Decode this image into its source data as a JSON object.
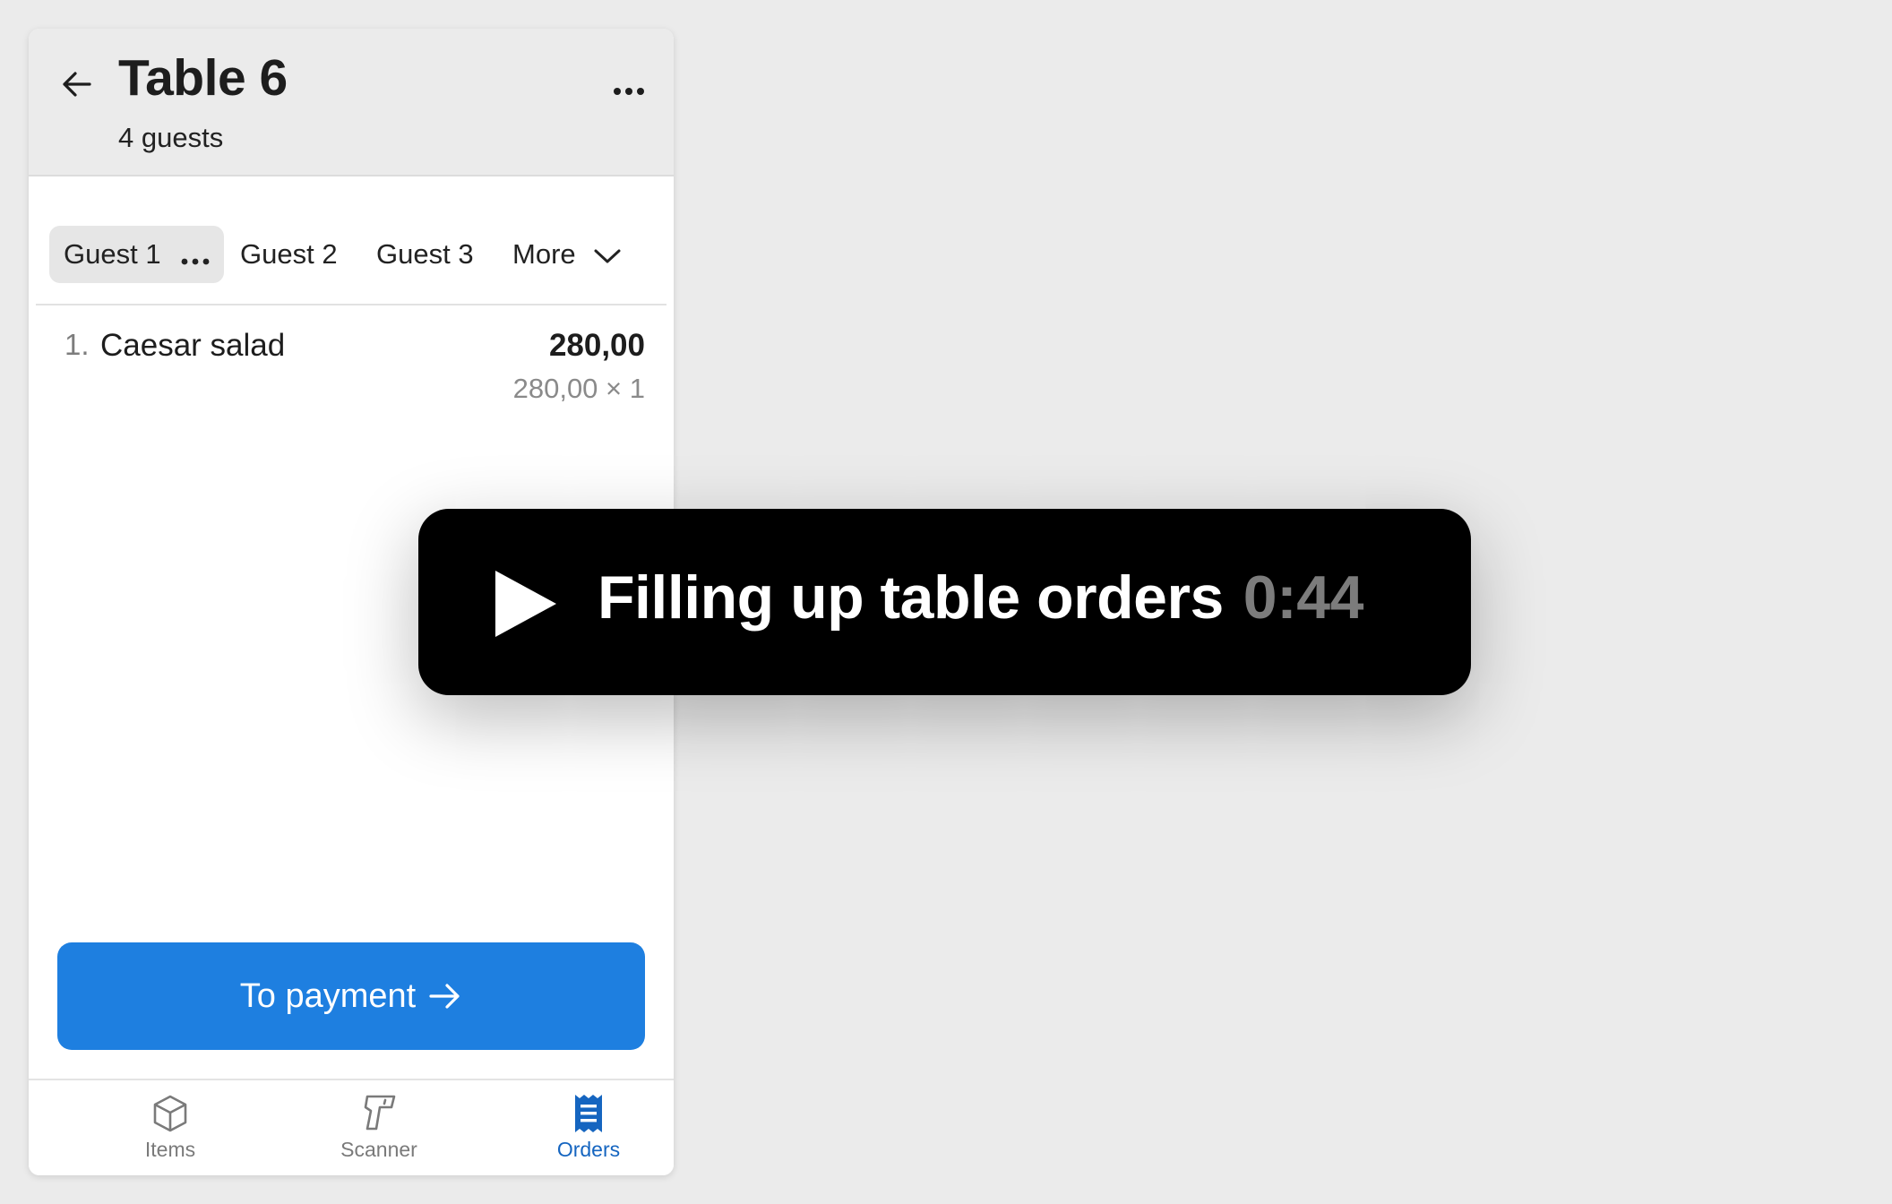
{
  "header": {
    "title": "Table 6",
    "subtitle": "4 guests"
  },
  "guest_tabs": [
    {
      "label": "Guest 1",
      "active": true
    },
    {
      "label": "Guest 2",
      "active": false
    },
    {
      "label": "Guest 3",
      "active": false
    }
  ],
  "more_label": "More",
  "order_items": [
    {
      "number": "1.",
      "name": "Caesar salad",
      "total": "280,00",
      "detail": "280,00 × 1"
    }
  ],
  "payment_button": {
    "label": "To payment"
  },
  "bottom_nav": [
    {
      "label": "Items",
      "icon": "box-icon",
      "active": false
    },
    {
      "label": "Scanner",
      "icon": "scanner-icon",
      "active": false
    },
    {
      "label": "Orders",
      "icon": "receipt-icon",
      "active": true
    }
  ],
  "video_overlay": {
    "title": "Filling up table orders",
    "duration": "0:44"
  },
  "colors": {
    "accent": "#1e7fe0",
    "nav_active": "#1565c0",
    "background": "#ebebeb",
    "overlay": "#000000"
  }
}
